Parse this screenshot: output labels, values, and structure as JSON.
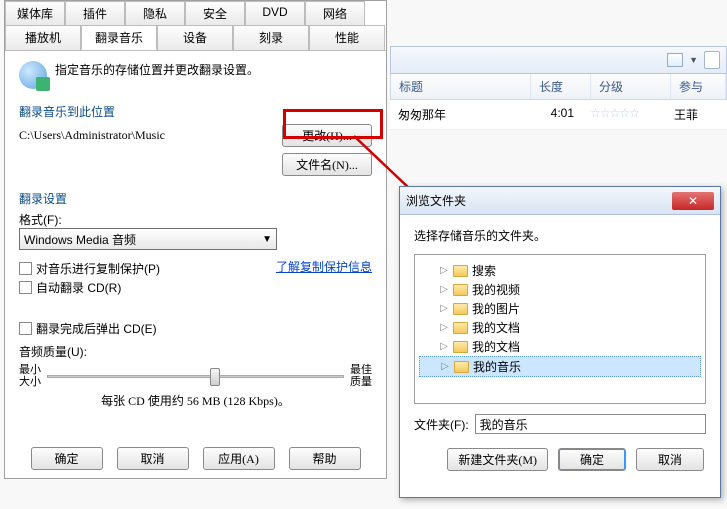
{
  "tabs_row1": [
    "媒体库",
    "插件",
    "隐私",
    "安全",
    "DVD",
    "网络"
  ],
  "tabs_row2": [
    "播放机",
    "翻录音乐",
    "设备",
    "刻录",
    "性能"
  ],
  "active_tab": "翻录音乐",
  "header_text": "指定音乐的存储位置并更改翻录设置。",
  "group1_title": "翻录音乐到此位置",
  "path": "C:\\Users\\Administrator\\Music",
  "change_btn": "更改(H)...",
  "filename_btn": "文件名(N)...",
  "group2_title": "翻录设置",
  "format_label": "格式(F):",
  "format_value": "Windows Media 音频",
  "chk_copyprotect": "对音乐进行复制保护(P)",
  "chk_autorip": "自动翻录 CD(R)",
  "link_copyprotect": "了解复制保护信息",
  "chk_eject": "翻录完成后弹出 CD(E)",
  "quality_label": "音频质量(U):",
  "slider_min": "最小\n大小",
  "slider_max": "最佳\n质量",
  "quality_hint": "每张 CD 使用约 56 MB (128 Kbps)。",
  "btn_ok": "确定",
  "btn_cancel": "取消",
  "btn_apply": "应用(A)",
  "btn_help": "帮助",
  "table_headers": {
    "title": "标题",
    "length": "长度",
    "rating": "分级",
    "part": "参与"
  },
  "rows": [
    {
      "title": "匆匆那年",
      "length": "4:01",
      "rating": "☆☆☆☆☆",
      "part": "王菲"
    }
  ],
  "dialog": {
    "title": "浏览文件夹",
    "prompt": "选择存储音乐的文件夹。",
    "tree": [
      "搜索",
      "我的视频",
      "我的图片",
      "我的文档",
      "我的文档",
      "我的音乐"
    ],
    "selected": "我的音乐",
    "folder_label": "文件夹(F):",
    "folder_value": "我的音乐",
    "btn_newfolder": "新建文件夹(M)",
    "btn_ok": "确定",
    "btn_cancel": "取消"
  }
}
